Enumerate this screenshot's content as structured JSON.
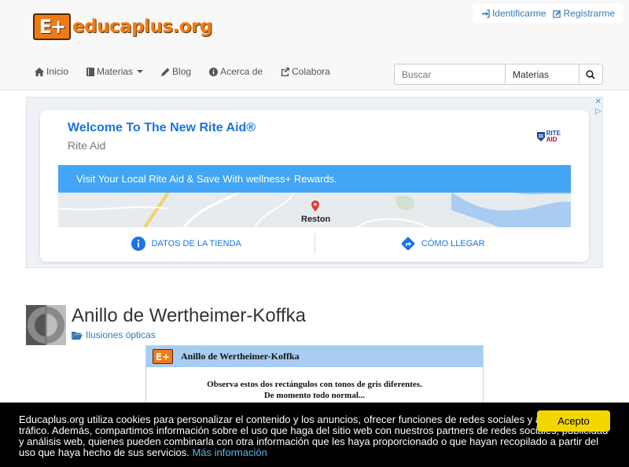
{
  "site": {
    "logo_mark": "E+",
    "logo_text": "educaplus.org"
  },
  "account": {
    "login": "Identificarme",
    "register": "Registrarme"
  },
  "nav": {
    "home": "Inicio",
    "subjects": "Materias",
    "blog": "Blog",
    "about": "Acerca de",
    "contribute": "Colabora"
  },
  "search": {
    "placeholder": "Buscar",
    "category": "Materias"
  },
  "ad": {
    "title": "Welcome To The New Rite Aid®",
    "advertiser": "Rite Aid",
    "logo_line1": "RITE",
    "logo_line2": "AID",
    "banner": "Visit Your Local Rite Aid & Save With wellness+ Rewards.",
    "map_label": "Reston",
    "store_details": "DATOS DE LA TIENDA",
    "directions": "CÓMO LLEGAR"
  },
  "article": {
    "title": "Anillo de Wertheimer-Koffka",
    "category": "Ilusiones ópticas",
    "preview_mark": "E+",
    "preview_title": "Anillo de Wertheimer-Koffka",
    "preview_line1": "Observa estos dos rectángulos con tonos de gris diferentes.",
    "preview_line2": "De momento todo normal..."
  },
  "cookie": {
    "text": "Educaplus.org utiliza cookies para personalizar el contenido y los anuncios, ofrecer funciones de redes sociales y analizar el tráfico. Además, compartimos información sobre el uso que haga del sitio web con nuestros partners de redes sociales, publicidad y análisis web, quienes pueden combinarla con otra información que les haya proporcionado o que hayan recopilado a partir del uso que haya hecho de sus servicios.",
    "more": "Más información",
    "accept": "Acepto"
  },
  "colors": {
    "brand_orange": "#f07b13",
    "link_blue": "#337ab7",
    "ad_blue": "#42a5f5",
    "accept_yellow": "#f1d600"
  }
}
